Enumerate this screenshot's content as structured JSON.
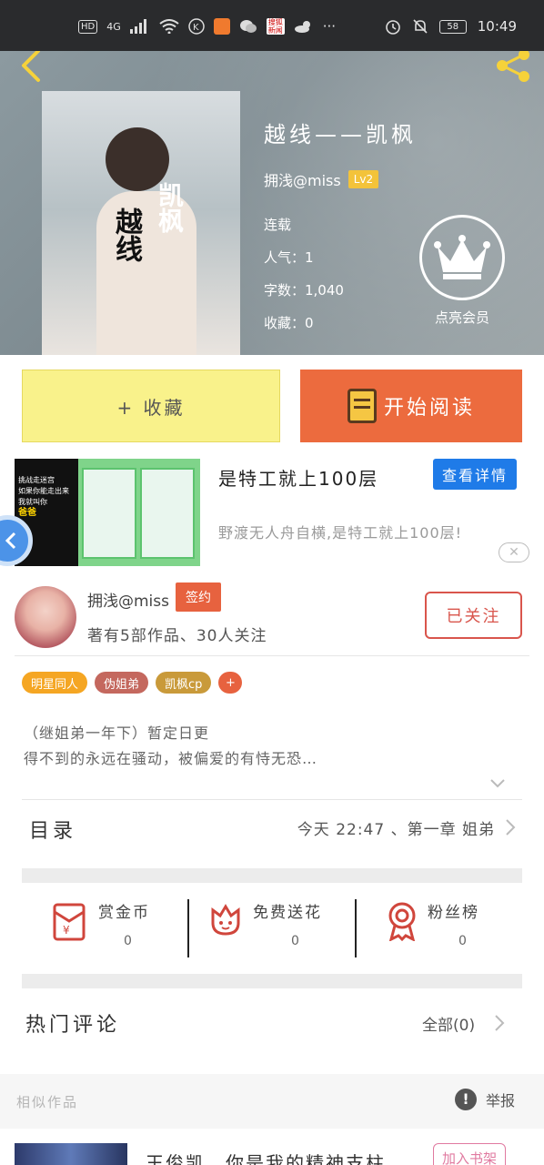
{
  "status_bar": {
    "hd": "HD",
    "network": "4G",
    "news_badge": "搜狐新闻",
    "dots": "···",
    "battery": "58",
    "time": "10:49"
  },
  "book": {
    "title": "越线——凯枫",
    "author": "拥浅@miss",
    "level": "Lv2",
    "status": "连载",
    "popularity": "人气：1",
    "word_count": "字数：1,040",
    "favorites": "收藏：0",
    "cover_text_a": "越线",
    "cover_text_b": "凯枫",
    "vip_label": "点亮会员"
  },
  "actions": {
    "collect": "+ 收藏",
    "read": "开始阅读"
  },
  "ad": {
    "title": "是特工就上100层",
    "button": "查看详情",
    "desc": "野渡无人舟自横,是特工就上100层!",
    "close": "✕",
    "img_line1": "挑战走迷宫",
    "img_line2": "如果你能走出来",
    "img_line3": "我就叫你",
    "img_line4": "爸爸"
  },
  "author": {
    "name": "拥浅@miss",
    "sign_tag": "签约",
    "stats": "著有5部作品、30人关注",
    "follow": "已关注"
  },
  "tags": [
    {
      "label": "明星同人",
      "color": "#f5a623"
    },
    {
      "label": "伪姐弟",
      "color": "#c4685e"
    },
    {
      "label": "凯枫cp",
      "color": "#c99a3a"
    },
    {
      "label": "+",
      "color": "#e7623f"
    }
  ],
  "description": {
    "line1": "（继姐弟一年下）暂定日更",
    "line2": "得不到的永远在骚动，被偏爱的有恃无恐…"
  },
  "toc": {
    "label": "目录",
    "latest": "今天 22:47 、第一章 姐弟"
  },
  "stats": {
    "coins_label": "赏金币",
    "coins_value": "0",
    "flowers_label": "免费送花",
    "flowers_value": "0",
    "fans_label": "粉丝榜",
    "fans_value": "0"
  },
  "comments": {
    "label": "热门评论",
    "all": "全部(0)"
  },
  "footer": {
    "similar": "相似作品",
    "report": "举报",
    "next_title": "王俊凯，你是我的精神支柱",
    "add_shelf": "加入书架"
  },
  "colors": {
    "accent_orange": "#ec6b3e",
    "collect_yellow": "#f9f28b",
    "ad_blue": "#1f7be8",
    "follow_red": "#d9554c"
  }
}
